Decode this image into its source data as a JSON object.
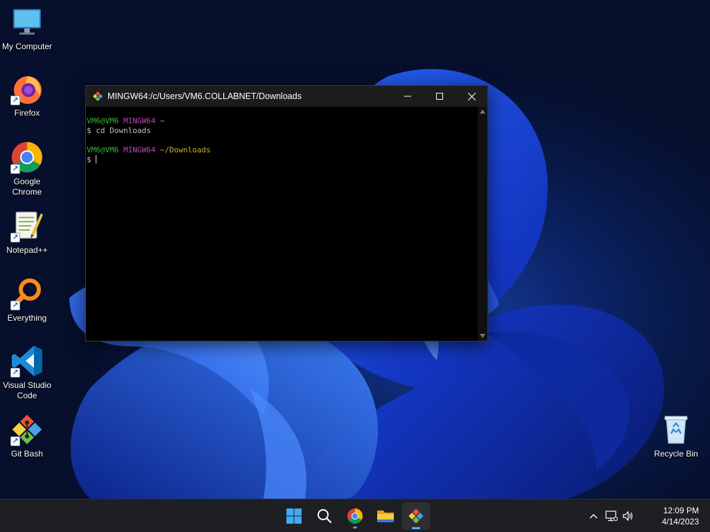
{
  "desktop": {
    "icons": [
      {
        "label": "My Computer",
        "icon": "monitor-icon"
      },
      {
        "label": "Firefox",
        "icon": "firefox-icon"
      },
      {
        "label": "Google Chrome",
        "icon": "chrome-icon"
      },
      {
        "label": "Notepad++",
        "icon": "notepadpp-icon"
      },
      {
        "label": "Everything",
        "icon": "everything-search-icon"
      },
      {
        "label": "Visual Studio Code",
        "icon": "vscode-icon"
      },
      {
        "label": "Git Bash",
        "icon": "git-bash-icon"
      },
      {
        "label": "Recycle Bin",
        "icon": "recycle-bin-icon"
      }
    ]
  },
  "terminal": {
    "title": "MINGW64:/c/Users/VM6.COLLABNET/Downloads",
    "lines": [
      {
        "user": "VM6@VM6",
        "host": "MINGW64",
        "path": "~"
      },
      {
        "command": "$ cd Downloads"
      },
      {
        "user": "VM6@VM6",
        "host": "MINGW64",
        "path": "~/Downloads"
      },
      {
        "prompt": "$ "
      }
    ],
    "colors": {
      "user": "#2fb52f",
      "host": "#b54ab5",
      "path": "#c9b13a"
    }
  },
  "taskbar": {
    "apps": [
      "start-icon",
      "search-icon",
      "chrome-icon",
      "file-explorer-icon",
      "git-bash-icon"
    ],
    "clock": {
      "time": "12:09 PM",
      "date": "4/14/2023"
    }
  }
}
